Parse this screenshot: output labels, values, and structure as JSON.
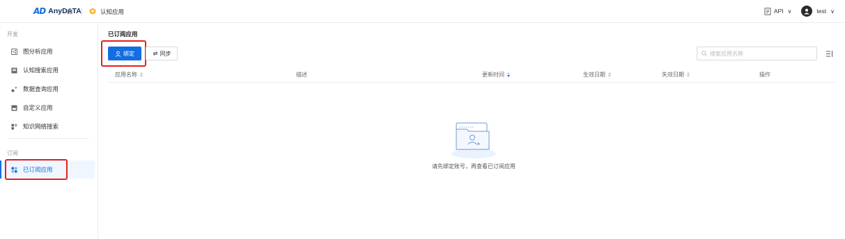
{
  "header": {
    "logo_mark": "AD",
    "logo_text": "AnyDATA",
    "breadcrumb": "认知应用",
    "api_label": "API",
    "user_name": "test"
  },
  "sidebar": {
    "group_dev": "开发",
    "dev_items": [
      {
        "label": "图分析应用",
        "icon": "graph-analysis-icon"
      },
      {
        "label": "认知搜索应用",
        "icon": "cognitive-search-icon"
      },
      {
        "label": "数据查询应用",
        "icon": "data-query-icon"
      },
      {
        "label": "自定义应用",
        "icon": "custom-app-icon"
      },
      {
        "label": "知识网络搜索",
        "icon": "knowledge-network-icon"
      }
    ],
    "group_sub": "订阅",
    "sub_items": [
      {
        "label": "已订阅应用",
        "icon": "subscribed-app-icon",
        "active": true
      }
    ]
  },
  "main": {
    "title": "已订阅应用",
    "bind_button": "绑定",
    "sync_button": "同步",
    "search_placeholder": "搜索应用名称",
    "columns": [
      "应用名称",
      "描述",
      "更新时间",
      "生效日期",
      "失效日期",
      "操作"
    ],
    "empty_text": "请先绑定账号，再查看已订阅应用"
  },
  "colors": {
    "primary": "#126ee3",
    "highlight": "#e02020"
  }
}
